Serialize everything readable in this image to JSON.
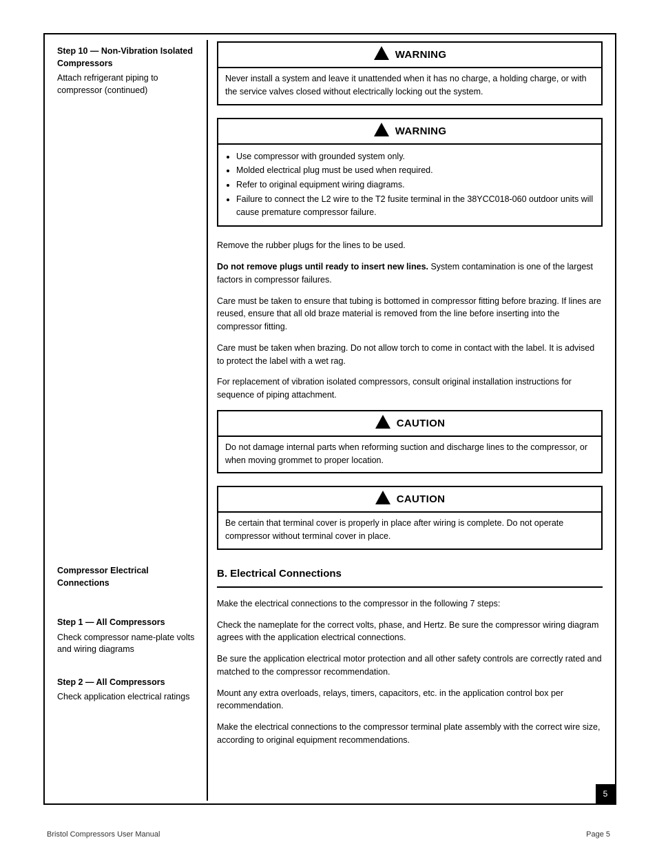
{
  "left": {
    "step_header": "Step 10 — Non-Vibration Isolated Compressors",
    "step_sub": "Attach refrigerant piping to compressor (continued)",
    "sect_b_header": "Compressor Electrical Connections",
    "b1_group": "Step 1 — All Compressors",
    "b1_action": "Check compressor name-plate volts and wiring diagrams",
    "b2_group": "Step 2 — All Compressors",
    "b2_action": "Check application electrical ratings"
  },
  "warnings": {
    "w1": {
      "title": "WARNING",
      "body": "Never install a system and leave it unattended when it has no charge, a holding charge, or with the service valves closed without electrically locking out the system."
    },
    "w2": {
      "title": "WARNING",
      "items": [
        "Use compressor with grounded system only.",
        "Molded electrical plug must be used when required.",
        "Refer to original equipment wiring diagrams.",
        "Failure to connect the L2 wire to the T2 fusite terminal in the 38YCC018-060 outdoor units will cause premature compressor failure."
      ]
    },
    "w3": {
      "title": "CAUTION",
      "body": "Do not damage internal parts when reforming suction and discharge lines to the compressor, or when moving grommet to proper location."
    },
    "w4": {
      "title": "CAUTION",
      "body": "Be certain that terminal cover is properly in place after wiring is complete. Do not operate compressor without terminal cover in place."
    }
  },
  "body": {
    "p1": "Remove the rubber plugs for the lines to be used.",
    "p2_a": "Do not remove plugs until ready to insert new lines.",
    "p2_b": " System contamination is one of the largest factors in compressor failures.",
    "p3": "Care must be taken to ensure that tubing is bottomed in compressor fitting before brazing. If lines are reused, ensure that all old braze material is removed from the line before inserting into the compressor fitting.",
    "p4": "Care must be taken when brazing. Do not allow torch to come in contact with the label. It is advised to protect the label with a wet rag.",
    "p5": "For replacement of vibration isolated compressors, consult original installation instructions for sequence of piping attachment.",
    "sectB_title": "B. Electrical Connections",
    "sectB_intro": "Make the electrical connections to the compressor in the following 7 steps:",
    "b1": "Check the nameplate for the correct volts, phase, and Hertz. Be sure the compressor wiring diagram agrees with the application electrical connections.",
    "b2": "Be sure the application electrical motor protection and all other safety controls are correctly rated and matched to the compressor recommendation.",
    "b2b": "Mount any extra overloads, relays, timers, capacitors, etc. in the application control box per recommendation.",
    "b2c": "Make the electrical connections to the compressor terminal plate assembly with the correct wire size, according to original equipment recommendations."
  },
  "footer": {
    "left": "Bristol Compressors User Manual",
    "right": "Page 5"
  },
  "page_tab": "5"
}
